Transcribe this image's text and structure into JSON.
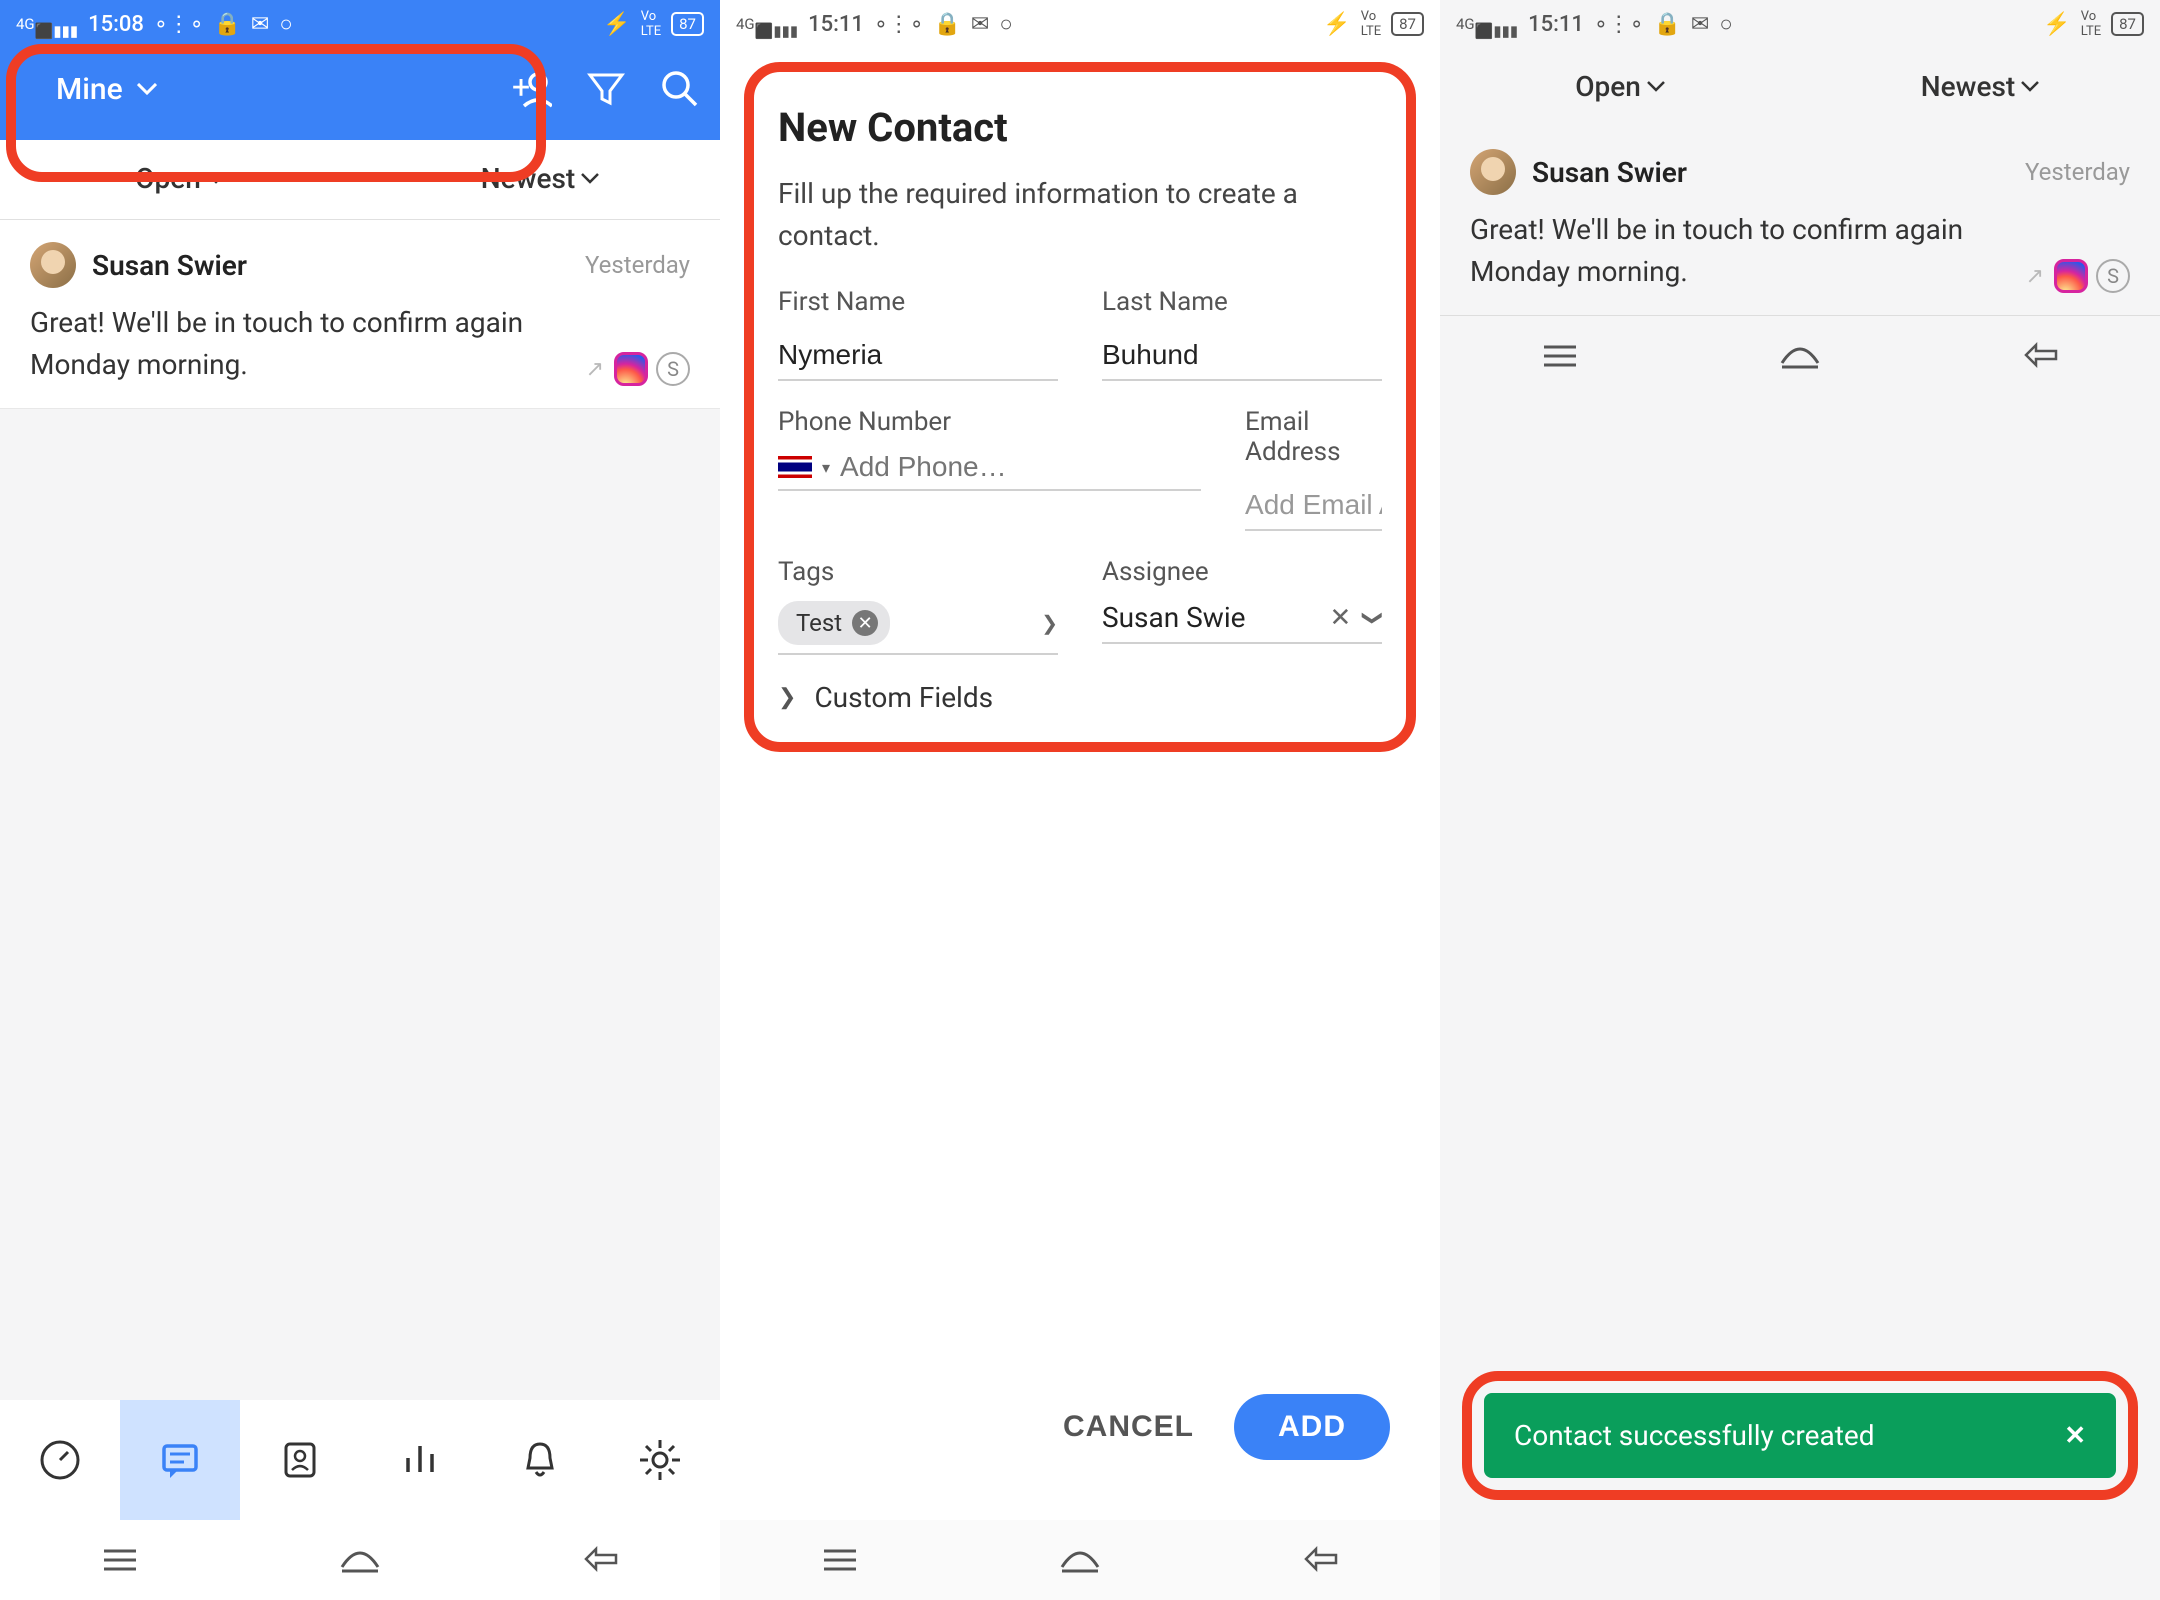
{
  "status": {
    "network": "4G",
    "time1": "15:08",
    "time2": "15:11",
    "time3": "15:11",
    "battery": "87"
  },
  "screen1": {
    "view_filter": "Mine",
    "filter_open": "Open",
    "filter_sort": "Newest",
    "msg": {
      "name": "Susan Swier",
      "time": "Yesterday",
      "body": "Great! We'll be in touch to confirm again Monday morning.",
      "badge": "S"
    }
  },
  "screen2": {
    "title": "New Contact",
    "desc": "Fill up the required information to create a contact.",
    "labels": {
      "first_name": "First Name",
      "last_name": "Last Name",
      "phone": "Phone Number",
      "email": "Email Address",
      "tags": "Tags",
      "assignee": "Assignee",
      "custom": "Custom Fields"
    },
    "values": {
      "first_name": "Nymeria",
      "last_name": "Buhund",
      "assignee": "Susan Swie",
      "tag": "Test"
    },
    "placeholders": {
      "phone": "Add Phone…",
      "email": "Add Email Address"
    },
    "buttons": {
      "cancel": "CANCEL",
      "add": "ADD"
    }
  },
  "screen3": {
    "filter_open": "Open",
    "filter_sort": "Newest",
    "toast": "Contact successfully created",
    "msg": {
      "name": "Susan Swier",
      "time": "Yesterday",
      "body": "Great! We'll be in touch to confirm again Monday morning.",
      "badge": "S"
    }
  }
}
